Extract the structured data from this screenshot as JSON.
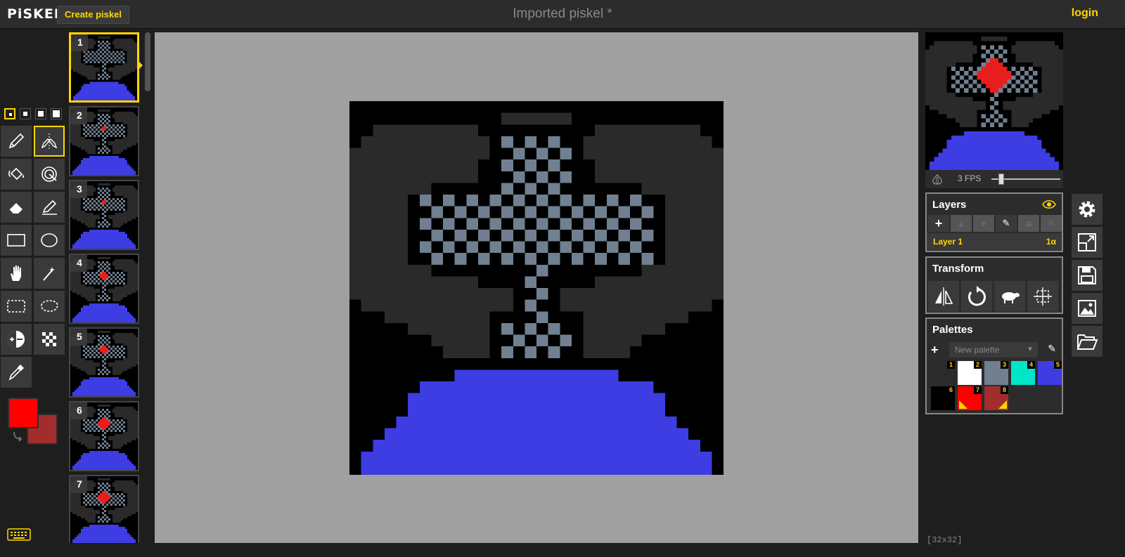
{
  "app": {
    "logo": "PiSKEL",
    "create_label": "Create piskel",
    "title": "Imported piskel *",
    "login_label": "login"
  },
  "frames": {
    "items": [
      {
        "num": "1"
      },
      {
        "num": "2"
      },
      {
        "num": "3"
      },
      {
        "num": "4"
      },
      {
        "num": "5"
      },
      {
        "num": "6"
      },
      {
        "num": "7"
      }
    ]
  },
  "preview": {
    "fps_label": "3 FPS",
    "fps_value": 3
  },
  "layers": {
    "title": "Layers",
    "items": [
      {
        "name": "Layer 1",
        "opacity": "1α"
      }
    ]
  },
  "transform": {
    "title": "Transform"
  },
  "palettes": {
    "title": "Palettes",
    "selected": "New palette",
    "colors": [
      {
        "num": "1",
        "color": "#2b2b2b"
      },
      {
        "num": "2",
        "color": "#ffffff"
      },
      {
        "num": "3",
        "color": "#708090"
      },
      {
        "num": "4",
        "color": "#00e5c8"
      },
      {
        "num": "5",
        "color": "#3d3de3"
      },
      {
        "num": "6",
        "color": "#000000"
      },
      {
        "num": "7",
        "color": "#ff0000"
      },
      {
        "num": "8",
        "color": "#a32d2d"
      }
    ]
  },
  "colors": {
    "primary": "#ff0000",
    "secondary": "#a32d2d",
    "accent": "#ffd700"
  },
  "status": {
    "dimensions": "[32x32]"
  },
  "tools": [
    "pen-tool",
    "vertical-mirror-tool",
    "paint-bucket-tool",
    "paint-all-similar-tool",
    "eraser-tool",
    "stroke-tool",
    "rectangle-tool",
    "circle-tool",
    "move-tool",
    "shape-selection-tool",
    "rectangle-selection-tool",
    "lasso-selection-tool",
    "lighten-tool",
    "dithering-tool",
    "color-picker-tool"
  ]
}
